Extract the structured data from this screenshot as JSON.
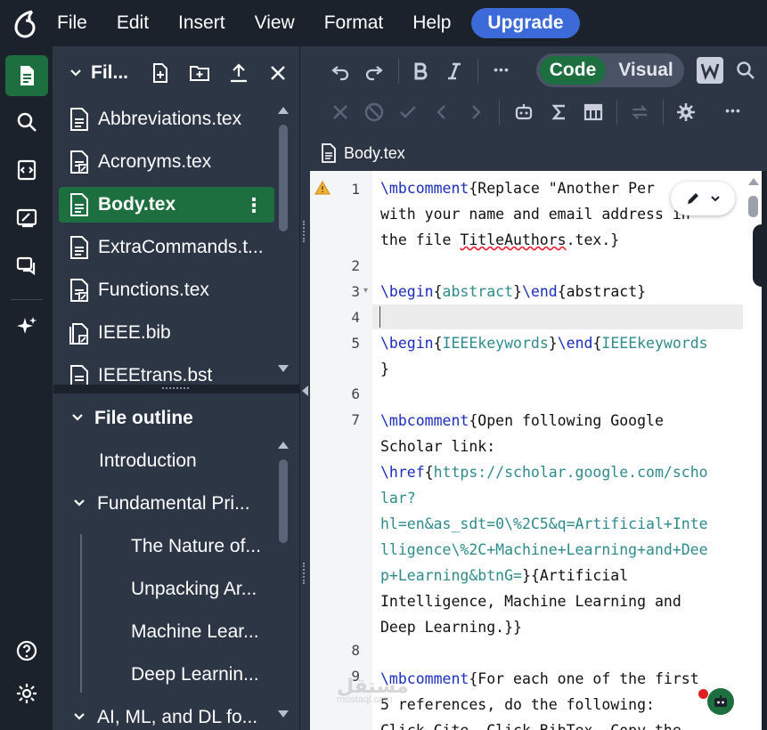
{
  "menubar": {
    "items": [
      "File",
      "Edit",
      "Insert",
      "View",
      "Format",
      "Help"
    ],
    "upgrade_label": "Upgrade"
  },
  "rail": {
    "icons": [
      "file-tree-icon",
      "search-icon",
      "integrations-icon",
      "review-icon",
      "chat-icon",
      "ai-sparkle-icon",
      "help-icon",
      "settings-icon"
    ]
  },
  "file_panel": {
    "title": "File tree",
    "title_display": "Fil...",
    "files": [
      {
        "name": "Abbreviations.tex",
        "type": "doc"
      },
      {
        "name": "Acronyms.tex",
        "type": "doc-linked"
      },
      {
        "name": "Body.tex",
        "type": "doc",
        "active": true
      },
      {
        "name": "ExtraCommands.t...",
        "type": "doc"
      },
      {
        "name": "Functions.tex",
        "type": "doc-linked"
      },
      {
        "name": "IEEE.bib",
        "type": "bib"
      },
      {
        "name": "IEEEtrans.bst",
        "type": "doc"
      }
    ]
  },
  "outline": {
    "title": "File outline",
    "items": [
      {
        "label": "Introduction",
        "level": 1
      },
      {
        "label": "Fundamental Pri...",
        "level": 1,
        "expanded": true
      },
      {
        "label": "The Nature of...",
        "level": 2
      },
      {
        "label": "Unpacking Ar...",
        "level": 2
      },
      {
        "label": "Machine Lear...",
        "level": 2
      },
      {
        "label": "Deep Learnin...",
        "level": 2
      },
      {
        "label": "AI, ML, and DL fo...",
        "level": 1,
        "expanded": true
      }
    ]
  },
  "toolbar": {
    "code_label": "Code",
    "visual_label": "Visual",
    "more_label": "•••"
  },
  "tab": {
    "filename": "Body.tex"
  },
  "editor": {
    "line_numbers": [
      "1",
      "2",
      "3",
      "4",
      "5",
      "6",
      "7",
      "8",
      "9"
    ]
  },
  "watermark": {
    "text": "مستقل",
    "sub": "mostaql.com"
  }
}
